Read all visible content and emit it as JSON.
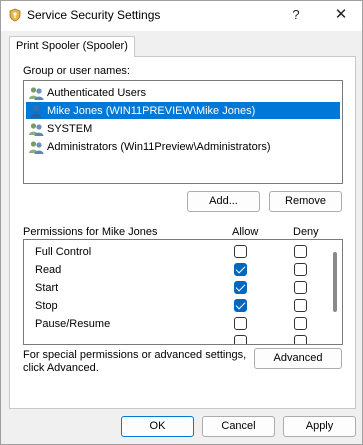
{
  "window": {
    "title": "Service Security Settings",
    "help_label": "?",
    "close_label": "✕"
  },
  "tab": {
    "label": "Print Spooler (Spooler)"
  },
  "users": {
    "header": "Group or user names:",
    "items": [
      {
        "name": "Authenticated Users",
        "icon": "users-group-icon",
        "selected": false
      },
      {
        "name": "Mike Jones (WIN11PREVIEW\\Mike Jones)",
        "icon": "user-icon",
        "selected": true
      },
      {
        "name": "SYSTEM",
        "icon": "users-group-icon",
        "selected": false
      },
      {
        "name": "Administrators (Win11Preview\\Administrators)",
        "icon": "users-group-icon",
        "selected": false
      }
    ]
  },
  "buttons": {
    "add": "Add...",
    "remove": "Remove",
    "advanced": "Advanced",
    "ok": "OK",
    "cancel": "Cancel",
    "apply": "Apply"
  },
  "permissions": {
    "header": "Permissions for Mike Jones",
    "allow_header": "Allow",
    "deny_header": "Deny",
    "items": [
      {
        "name": "Full Control",
        "allow": false,
        "deny": false
      },
      {
        "name": "Read",
        "allow": true,
        "deny": false
      },
      {
        "name": "Start",
        "allow": true,
        "deny": false
      },
      {
        "name": "Stop",
        "allow": true,
        "deny": false
      },
      {
        "name": "Pause/Resume",
        "allow": false,
        "deny": false
      },
      {
        "name": "",
        "allow": false,
        "deny": false
      }
    ]
  },
  "advanced_text": {
    "line1": "For special permissions or advanced settings,",
    "line2": "click Advanced."
  },
  "colors": {
    "selection": "#0078d7",
    "checkbox_checked": "#0067c0"
  }
}
